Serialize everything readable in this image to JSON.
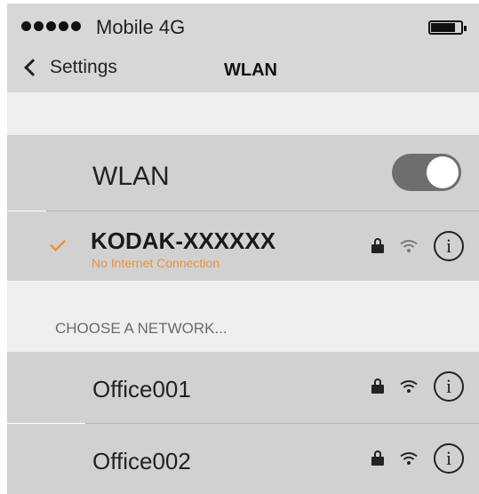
{
  "status_bar": {
    "carrier": "Mobile  4G",
    "signal_bars": 5
  },
  "nav": {
    "back_label": "Settings",
    "title": "WLAN"
  },
  "wlan": {
    "label": "WLAN",
    "enabled": true
  },
  "connected_network": {
    "name": "KODAK-XXXXXX",
    "status": "No Internet Connection",
    "secured": true
  },
  "choose_section": {
    "header": "CHOOSE A NETWORK..."
  },
  "networks": [
    {
      "name": "Office001",
      "secured": true
    },
    {
      "name": "Office002",
      "secured": true
    }
  ],
  "icons": {
    "back": "chevron-left-icon",
    "lock": "lock-icon",
    "wifi": "wifi-icon",
    "info": "info-icon",
    "check": "checkmark-icon",
    "battery": "battery-icon"
  },
  "colors": {
    "accent": "#e8923a",
    "toggle_on": "#6e6e6e",
    "row_background": "#d1d1d1",
    "section_background": "#efefef"
  }
}
